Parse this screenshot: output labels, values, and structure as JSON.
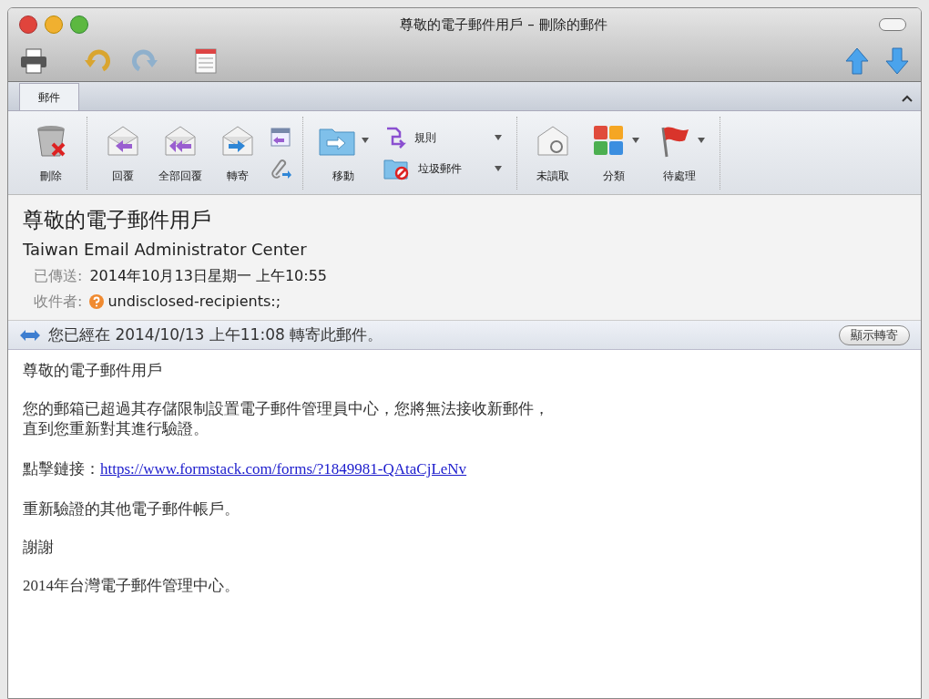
{
  "window": {
    "title": "尊敬的電子郵件用戶 – 刪除的郵件"
  },
  "tabs": [
    {
      "label": "郵件",
      "selected": true
    }
  ],
  "ribbon": [
    [
      {
        "kind": "big",
        "label": "刪除",
        "dropdown": false
      }
    ],
    [
      {
        "kind": "big",
        "label": "回覆",
        "dropdown": false
      },
      {
        "kind": "big",
        "label": "全部回覆",
        "dropdown": false
      },
      {
        "kind": "big",
        "label": "轉寄",
        "dropdown": false
      },
      {
        "kind": "stack"
      }
    ],
    [
      {
        "kind": "big",
        "label": "移動",
        "dropdown": true
      },
      {
        "kind": "menus",
        "items": [
          {
            "label": "規則"
          },
          {
            "label": "垃圾郵件"
          }
        ]
      }
    ],
    [
      {
        "kind": "big",
        "label": "未讀取",
        "dropdown": false
      },
      {
        "kind": "big",
        "label": "分類",
        "dropdown": true
      },
      {
        "kind": "big",
        "label": "待處理",
        "dropdown": true
      }
    ]
  ],
  "message": {
    "subject": "尊敬的電子郵件用戶",
    "from": "Taiwan Email Administrator Center",
    "fields": [
      {
        "label": "已傳送:",
        "value": "2014年10月13日星期一 上午10:55",
        "kind": "text"
      },
      {
        "label": "收件者:",
        "value": "undisclosed-recipients:;",
        "kind": "contact"
      }
    ]
  },
  "forward_bar": {
    "text": "您已經在 2014/10/13 上午11:08 轉寄此郵件。",
    "button": "顯示轉寄"
  },
  "body": [
    {
      "kind": "text",
      "text": "尊敬的電子郵件用戶"
    },
    {
      "kind": "text",
      "text": "您的郵箱已超過其存儲限制設置電子郵件管理員中心，您將無法接收新郵件，直到您重新對其進行驗證。"
    },
    {
      "kind": "link",
      "text": "點擊鏈接：",
      "link": "https://www.formstack.com/forms/?1849981-QAtaCjLeNv"
    },
    {
      "kind": "text",
      "text": "重新驗證的其他電子郵件帳戶。"
    },
    {
      "kind": "text",
      "text": "謝謝"
    },
    {
      "kind": "text",
      "text": "2014年台灣電子郵件管理中心。"
    }
  ]
}
